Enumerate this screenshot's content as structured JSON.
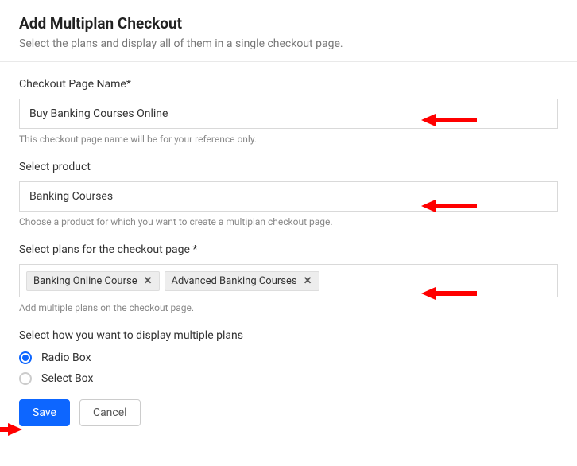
{
  "header": {
    "title": "Add Multiplan Checkout",
    "subtitle": "Select the plans and display all of them in a single checkout page."
  },
  "fields": {
    "pageName": {
      "label": "Checkout Page Name*",
      "value": "Buy Banking Courses Online",
      "help": "This checkout page name will be for your reference only."
    },
    "product": {
      "label": "Select product",
      "value": "Banking Courses",
      "help": "Choose a product for which you want to create a multiplan checkout page."
    },
    "plans": {
      "label": "Select plans for the checkout page *",
      "tags": [
        "Banking Online Course",
        "Advanced Banking Courses"
      ],
      "help": "Add multiple plans on the checkout page."
    },
    "display": {
      "label": "Select how you want to display multiple plans",
      "options": [
        {
          "label": "Radio Box",
          "checked": true
        },
        {
          "label": "Select Box",
          "checked": false
        }
      ]
    }
  },
  "buttons": {
    "save": "Save",
    "cancel": "Cancel"
  }
}
